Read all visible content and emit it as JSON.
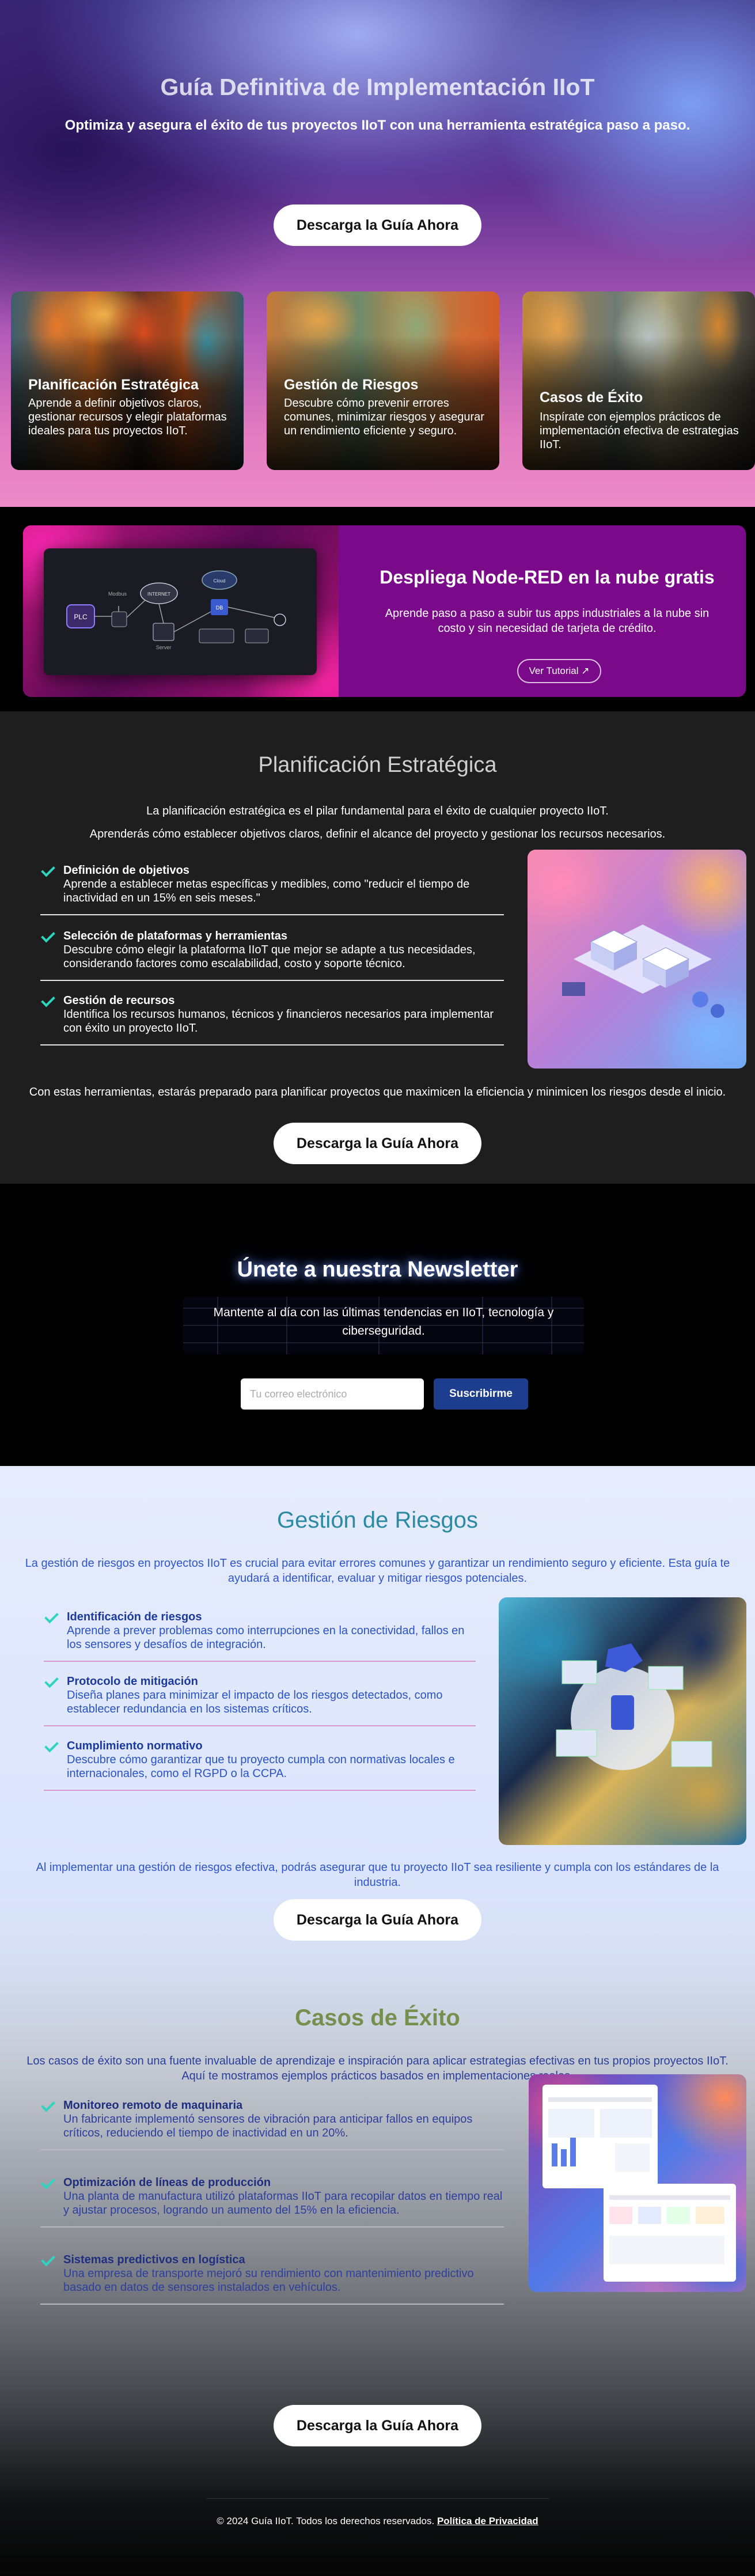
{
  "hero": {
    "title": "Guía Definitiva de Implementación IIoT",
    "subtitle": "Optimiza y asegura el éxito de tus proyectos IIoT con una herramienta estratégica paso a paso.",
    "cta": "Descarga la Guía Ahora",
    "cards": [
      {
        "title": "Planificación Estratégica",
        "text": "Aprende a definir objetivos claros, gestionar recursos y elegir plataformas ideales para tus proyectos IIoT."
      },
      {
        "title": "Gestión de Riesgos",
        "text": "Descubre cómo prevenir errores comunes, minimizar riesgos y asegurar un rendimiento eficiente y seguro."
      },
      {
        "title": "Casos de Éxito",
        "text": "Inspírate con ejemplos prácticos de implementación efectiva de estrategias IIoT."
      }
    ]
  },
  "nodered": {
    "title": "Despliega Node-RED en la nube gratis",
    "text": "Aprende paso a paso a subir tus apps industriales a la nube sin costo y sin necesidad de tarjeta de crédito.",
    "button": "Ver Tutorial ↗",
    "diagram": {
      "left_label": "PLC",
      "top_label": "Modbus",
      "cloud": "INTERNET",
      "mid": "Server",
      "cloud2": "Cloud",
      "db": "DB"
    }
  },
  "plan": {
    "title": "Planificación Estratégica",
    "intro1": "La planificación estratégica es el pilar fundamental para el éxito de cualquier proyecto IIoT.",
    "intro2": "Aprenderás cómo establecer objetivos claros, definir el alcance del proyecto y gestionar los recursos necesarios.",
    "items": [
      {
        "title": "Definición de objetivos",
        "text": "Aprende a establecer metas específicas y medibles, como \"reducir el tiempo de inactividad en un 15% en seis meses.\""
      },
      {
        "title": "Selección de plataformas y herramientas",
        "text": "Descubre cómo elegir la plataforma IIoT que mejor se adapte a tus necesidades, considerando factores como escalabilidad, costo y soporte técnico."
      },
      {
        "title": "Gestión de recursos",
        "text": "Identifica los recursos humanos, técnicos y financieros necesarios para implementar con éxito un proyecto IIoT."
      }
    ],
    "outro": "Con estas herramientas, estarás preparado para planificar proyectos que maximicen la eficiencia y minimicen los riesgos desde el inicio.",
    "cta": "Descarga la Guía Ahora"
  },
  "newsletter": {
    "title": "Únete a nuestra Newsletter",
    "text": "Mantente al día con las últimas tendencias en IIoT, tecnología y ciberseguridad.",
    "placeholder": "Tu correo electrónico",
    "button": "Suscribirme"
  },
  "riesgos": {
    "title": "Gestión de Riesgos",
    "intro": "La gestión de riesgos en proyectos IIoT es crucial para evitar errores comunes y garantizar un rendimiento seguro y eficiente. Esta guía te ayudará a identificar, evaluar y mitigar riesgos potenciales.",
    "items": [
      {
        "title": "Identificación de riesgos",
        "text": "Aprende a prever problemas como interrupciones en la conectividad, fallos en los sensores y desafíos de integración."
      },
      {
        "title": "Protocolo de mitigación",
        "text": "Diseña planes para minimizar el impacto de los riesgos detectados, como establecer redundancia en los sistemas críticos."
      },
      {
        "title": "Cumplimiento normativo",
        "text": "Descubre cómo garantizar que tu proyecto cumpla con normativas locales e internacionales, como el RGPD o la CCPA."
      }
    ],
    "outro": "Al implementar una gestión de riesgos efectiva, podrás asegurar que tu proyecto IIoT sea resiliente y cumpla con los estándares de la industria.",
    "cta": "Descarga la Guía Ahora"
  },
  "exito": {
    "title": "Casos de Éxito",
    "intro": "Los casos de éxito son una fuente invaluable de aprendizaje e inspiración para aplicar estrategias efectivas en tus propios proyectos IIoT. Aquí te mostramos ejemplos prácticos basados en implementaciones reales.",
    "items": [
      {
        "title": "Monitoreo remoto de maquinaria",
        "text": "Un fabricante implementó sensores de vibración para anticipar fallos en equipos críticos, reduciendo el tiempo de inactividad en un 20%."
      },
      {
        "title": "Optimización de líneas de producción",
        "text": "Una planta de manufactura utilizó plataformas IIoT para recopilar datos en tiempo real y ajustar procesos, logrando un aumento del 15% en la eficiencia."
      },
      {
        "title": "Sistemas predictivos en logística",
        "text": "Una empresa de transporte mejoró su rendimiento con mantenimiento predictivo basado en datos de sensores instalados en vehículos."
      }
    ],
    "cta": "Descarga la Guía Ahora",
    "footer_text": "© 2024 Guía IIoT. Todos los derechos reservados.",
    "footer_link": "Política de Privacidad"
  },
  "colors": {
    "accent_teal": "#2dd4bf",
    "newsletter_button": "#1d3d8f",
    "nodered_bg": "#7b0a8a",
    "riesgos_title": "#2c8aa2",
    "exito_title": "#74904c"
  }
}
